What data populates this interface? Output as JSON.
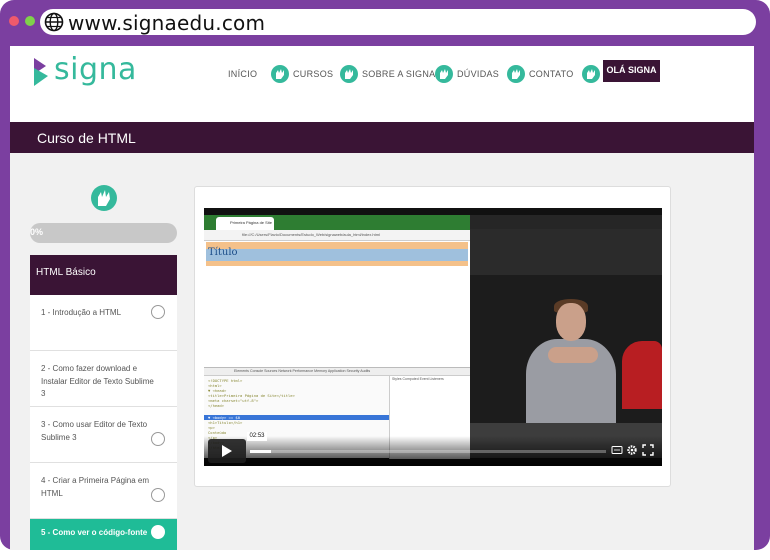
{
  "browser": {
    "url": "www.signaedu.com"
  },
  "site": {
    "logo_text": "signa",
    "nav": [
      "INÍCIO",
      "CURSOS",
      "SOBRE A SIGNA",
      "DÚVIDAS",
      "CONTATO"
    ],
    "user_button": "OLÁ SIGNA",
    "colors": {
      "purple_dark": "#3a1435",
      "teal": "#35b99c",
      "frame": "#7b3fa0",
      "active_lesson": "#1fbc97"
    }
  },
  "course": {
    "title": "Curso de HTML",
    "progress_label": "0%",
    "progress": 0,
    "module_title": "HTML Básico",
    "lessons": [
      {
        "label": "1 - Introdução a HTML",
        "active": false
      },
      {
        "label": "2 - Como fazer download e Instalar Editor de Texto Sublime 3",
        "active": false
      },
      {
        "label": "3 - Como usar Editor de Texto Sublime 3",
        "active": false
      },
      {
        "label": "4 - Criar a Primeira Página em HTML",
        "active": false
      },
      {
        "label": "5 - Como ver o código-fonte",
        "active": true
      }
    ]
  },
  "video": {
    "time": "02:53",
    "browser_tab": "Primeira Página de Site",
    "address": "file:///C:/Users/Flavio/Documents/Estudo_Web/signaweb/aula_html/index.html",
    "page_heading": "Título",
    "devtools_tabs": "Elements  Console  Sources  Network  Performance  Memory  Application  Security  Audits",
    "styles_tabs": "Styles  Computed  Event Listeners",
    "code_lines": [
      "<!DOCTYPE html>",
      "<html>",
      "▼ <head>",
      "   <title>Primeira Página de Site</title>",
      "   <meta charset=\"utf-8\">",
      " </head>",
      "▼ <body> == $0",
      "   <h1>Título</h1>",
      "   <p>",
      "     Conteúdo",
      "   </p>",
      " </body>",
      "</html>"
    ],
    "progress": 0.06
  }
}
